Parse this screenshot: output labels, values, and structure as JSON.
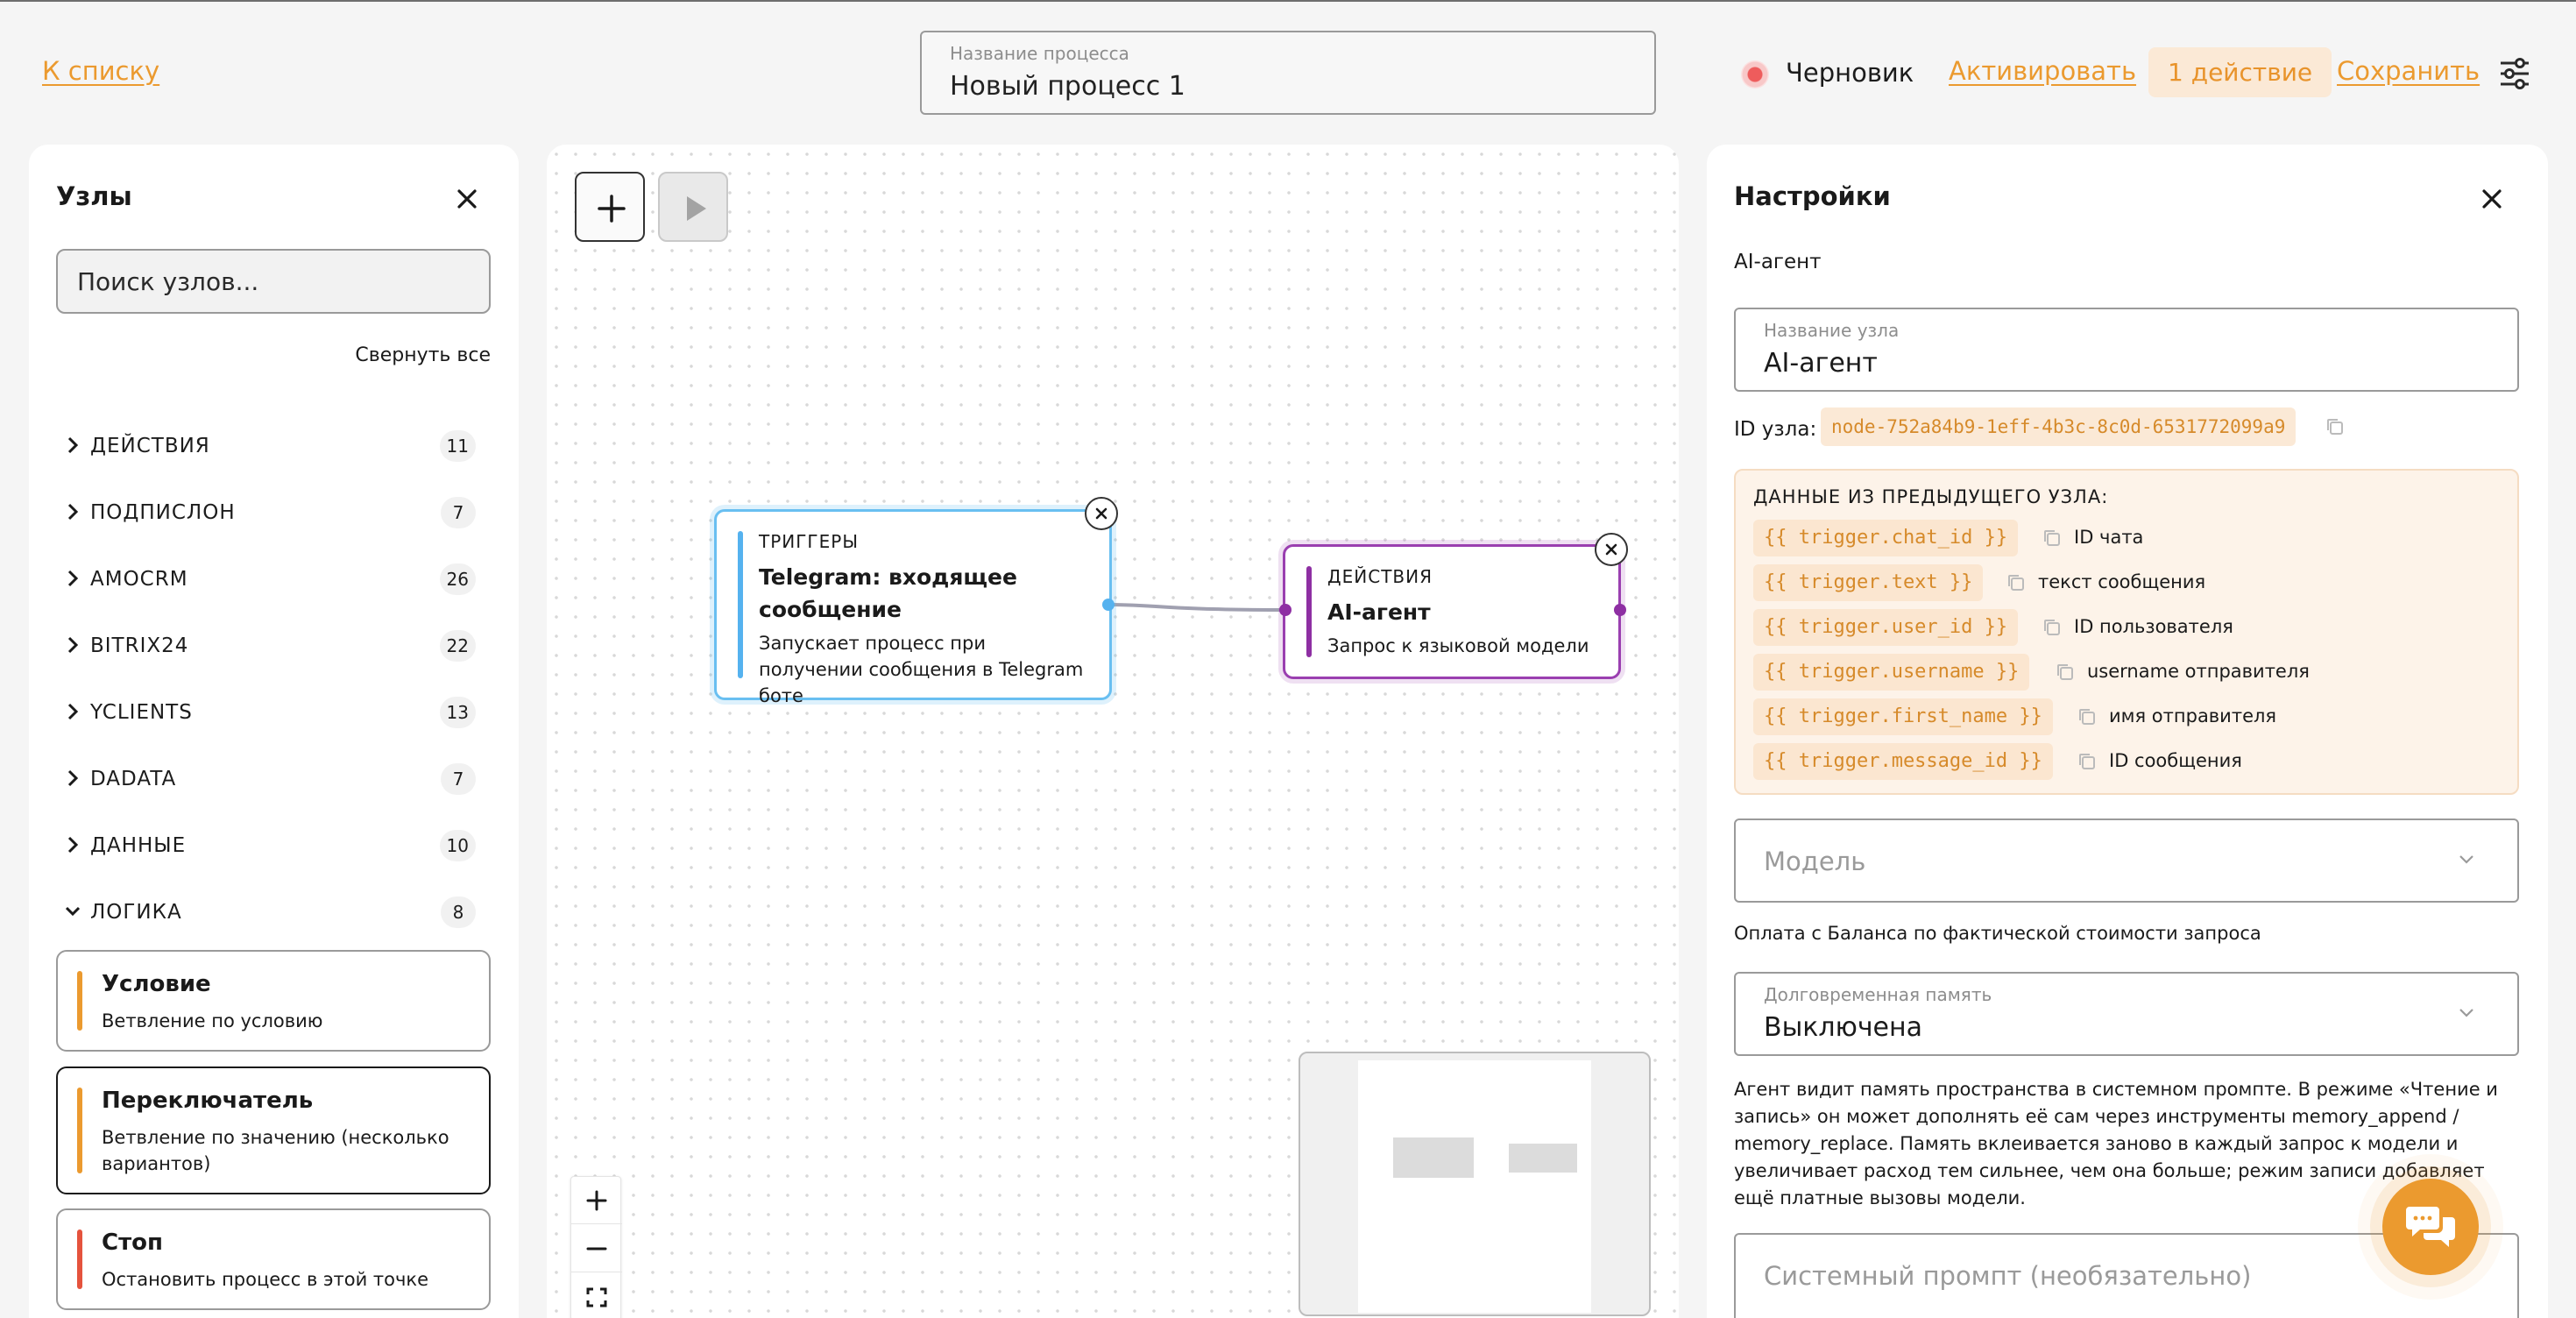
{
  "header": {
    "back_link": "К списку",
    "process_name_label": "Название процесса",
    "process_name_value": "Новый процесс 1",
    "status": "Черновик",
    "activate": "Активировать",
    "actions_count": "1 действие",
    "save": "Сохранить"
  },
  "nodes_panel": {
    "title": "Узлы",
    "search_placeholder": "Поиск узлов...",
    "collapse_all": "Свернуть все",
    "categories": [
      {
        "label": "ДЕЙСТВИЯ",
        "count": "11"
      },
      {
        "label": "ПОДПИСЛОН",
        "count": "7"
      },
      {
        "label": "AMOCRM",
        "count": "26"
      },
      {
        "label": "BITRIX24",
        "count": "22"
      },
      {
        "label": "YCLIENTS",
        "count": "13"
      },
      {
        "label": "DADATA",
        "count": "7"
      },
      {
        "label": "ДАННЫЕ",
        "count": "10"
      },
      {
        "label": "ЛОГИКА",
        "count": "8"
      }
    ],
    "logic_items": [
      {
        "title": "Условие",
        "desc": "Ветвление по условию",
        "color": "#eb9a2f"
      },
      {
        "title": "Переключатель",
        "desc": "Ветвление по значению (несколько вариантов)",
        "color": "#eb9a2f"
      },
      {
        "title": "Стоп",
        "desc": "Остановить процесс в этой точке",
        "color": "#e5533d"
      }
    ]
  },
  "canvas": {
    "nodes": [
      {
        "category": "ТРИГГЕРЫ",
        "title": "Telegram: входящее сообщение",
        "desc": "Запускает процесс при получении сообщения в Telegram боте",
        "color": "#55b2ef"
      },
      {
        "category": "ДЕЙСТВИЯ",
        "title": "AI-агент",
        "desc": "Запрос к языковой модели",
        "color": "#8e2fa3"
      }
    ]
  },
  "settings": {
    "title": "Настройки",
    "node_type": "AI-агент",
    "node_name_label": "Название узла",
    "node_name_value": "AI-агент",
    "node_id_label": "ID узла:",
    "node_id_value": "node-752a84b9-1eff-4b3c-8c0d-6531772099a9",
    "prev_data_title": "ДАННЫЕ ИЗ ПРЕДЫДУЩЕГО УЗЛА:",
    "variables": [
      {
        "var": "{{ trigger.chat_id }}",
        "desc": "ID чата"
      },
      {
        "var": "{{ trigger.text }}",
        "desc": "текст сообщения"
      },
      {
        "var": "{{ trigger.user_id }}",
        "desc": "ID пользователя"
      },
      {
        "var": "{{ trigger.username }}",
        "desc": "username отправителя"
      },
      {
        "var": "{{ trigger.first_name }}",
        "desc": "имя отправителя"
      },
      {
        "var": "{{ trigger.message_id }}",
        "desc": "ID сообщения"
      }
    ],
    "model_placeholder": "Модель",
    "billing_note": "Оплата с Баланса по фактической стоимости запроса",
    "memory_label": "Долговременная память",
    "memory_value": "Выключена",
    "memory_note": "Агент видит память пространства в системном промпте. В режиме «Чтение и запись» он может дополнять её сам через инструменты memory_append / memory_replace. Память вклеивается заново в каждый запрос к модели и увеличивает расход тем сильнее, чем она больше; режим записи добавляет ещё платные вызовы модели.",
    "system_prompt_placeholder": "Системный промпт (необязательно)"
  },
  "colors": {
    "accent": "#eb9a2f",
    "trigger": "#55b2ef",
    "action": "#8e2fa3",
    "stop": "#e5533d"
  }
}
